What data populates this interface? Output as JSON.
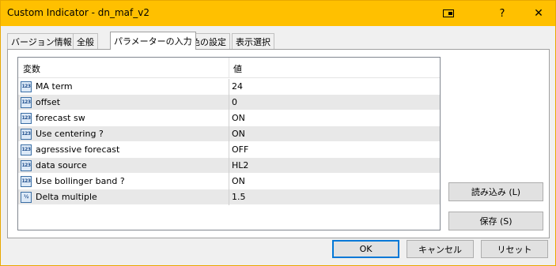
{
  "window": {
    "title": "Custom Indicator - dn_maf_v2",
    "help_label": "?",
    "close_label": "✕"
  },
  "tabs": [
    {
      "label": "バージョン情報",
      "active": false
    },
    {
      "label": "全般",
      "active": false
    },
    {
      "label": "パラメーターの入力",
      "active": true
    },
    {
      "label": "色の設定",
      "active": false
    },
    {
      "label": "表示選択",
      "active": false
    }
  ],
  "grid": {
    "header": {
      "variable": "変数",
      "value": "値"
    },
    "rows": [
      {
        "icon": "int-icon",
        "icon_text": "123",
        "name": "MA term",
        "value": "24"
      },
      {
        "icon": "int-icon",
        "icon_text": "123",
        "name": "offset",
        "value": "0"
      },
      {
        "icon": "int-icon",
        "icon_text": "123",
        "name": "forecast sw",
        "value": "ON"
      },
      {
        "icon": "int-icon",
        "icon_text": "123",
        "name": "Use centering ?",
        "value": "ON"
      },
      {
        "icon": "int-icon",
        "icon_text": "123",
        "name": "agresssive forecast",
        "value": "OFF"
      },
      {
        "icon": "int-icon",
        "icon_text": "123",
        "name": "data source",
        "value": "HL2"
      },
      {
        "icon": "int-icon",
        "icon_text": "123",
        "name": "Use bollinger band ?",
        "value": "ON"
      },
      {
        "icon": "double-icon",
        "icon_text": "½",
        "name": "Delta multiple",
        "value": "1.5"
      }
    ]
  },
  "side_buttons": {
    "load": "読み込み (L)",
    "save": "保存 (S)"
  },
  "dialog_buttons": {
    "ok": "OK",
    "cancel": "キャンセル",
    "reset": "リセット"
  }
}
